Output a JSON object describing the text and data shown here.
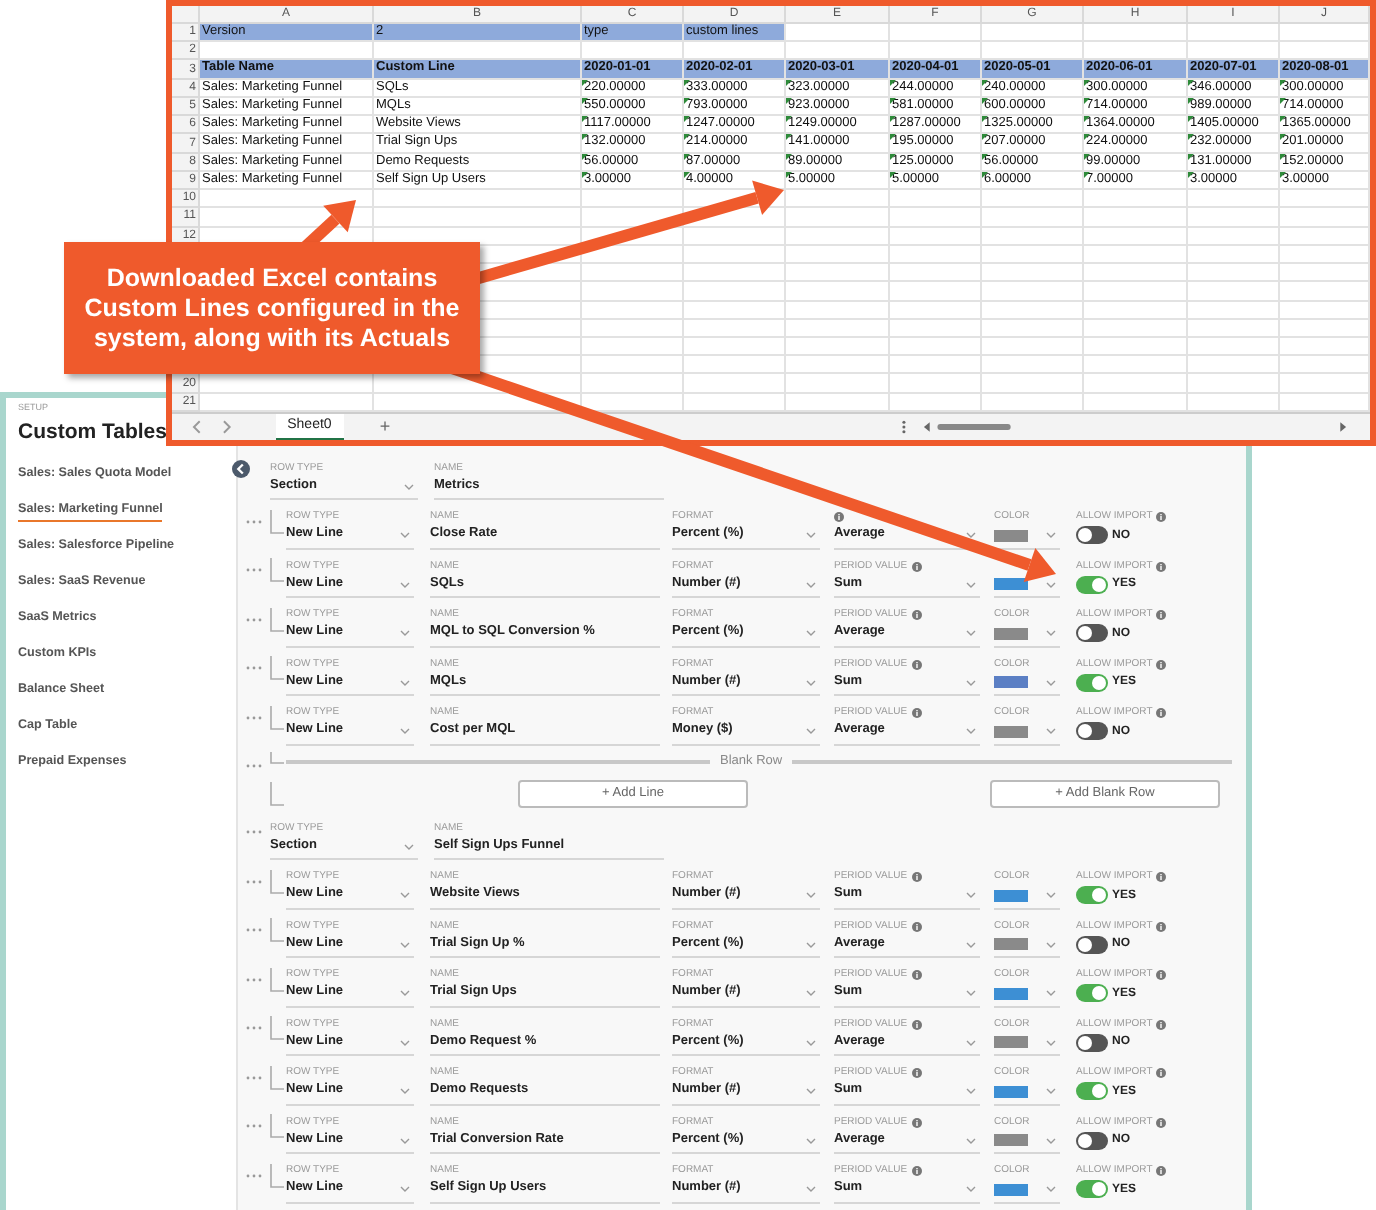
{
  "spreadsheet": {
    "column_headers": [
      "A",
      "B",
      "C",
      "D",
      "E",
      "F",
      "G",
      "H",
      "I",
      "J"
    ],
    "rows": [
      {
        "number": "1",
        "kind": "meta",
        "cells": [
          "Version",
          "2",
          "type",
          "custom lines"
        ]
      },
      {
        "number": "2",
        "kind": "blank",
        "cells": []
      },
      {
        "number": "3",
        "kind": "header",
        "cells": [
          "Table Name",
          "Custom Line",
          "2020-01-01",
          "2020-02-01",
          "2020-03-01",
          "2020-04-01",
          "2020-05-01",
          "2020-06-01",
          "2020-07-01",
          "2020-08-01"
        ]
      },
      {
        "number": "4",
        "kind": "data",
        "cells": [
          "Sales: Marketing Funnel",
          "SQLs",
          "220.00000",
          "333.00000",
          "323.00000",
          "244.00000",
          "240.00000",
          "300.00000",
          "346.00000",
          "300.00000"
        ]
      },
      {
        "number": "5",
        "kind": "data",
        "cells": [
          "Sales: Marketing Funnel",
          "MQLs",
          "550.00000",
          "793.00000",
          "923.00000",
          "581.00000",
          "600.00000",
          "714.00000",
          "989.00000",
          "714.00000"
        ]
      },
      {
        "number": "6",
        "kind": "data",
        "cells": [
          "Sales: Marketing Funnel",
          "Website Views",
          "1117.00000",
          "1247.00000",
          "1249.00000",
          "1287.00000",
          "1325.00000",
          "1364.00000",
          "1405.00000",
          "1365.00000"
        ]
      },
      {
        "number": "7",
        "kind": "data",
        "cells": [
          "Sales: Marketing Funnel",
          "Trial Sign Ups",
          "132.00000",
          "214.00000",
          "141.00000",
          "195.00000",
          "207.00000",
          "224.00000",
          "232.00000",
          "201.00000"
        ]
      },
      {
        "number": "8",
        "kind": "data",
        "cells": [
          "Sales: Marketing Funnel",
          "Demo Requests",
          "56.00000",
          "87.00000",
          "89.00000",
          "125.00000",
          "56.00000",
          "99.00000",
          "131.00000",
          "152.00000"
        ]
      },
      {
        "number": "9",
        "kind": "data",
        "cells": [
          "Sales: Marketing Funnel",
          "Self Sign Up Users",
          "3.00000",
          "4.00000",
          "5.00000",
          "5.00000",
          "6.00000",
          "7.00000",
          "3.00000",
          "3.00000"
        ]
      },
      {
        "number": "10",
        "kind": "blank",
        "cells": []
      },
      {
        "number": "11",
        "kind": "blank",
        "cells": []
      },
      {
        "number": "12",
        "kind": "blank",
        "cells": []
      },
      {
        "number": "20",
        "kind": "blank",
        "cells": [],
        "gap_before": true
      },
      {
        "number": "21",
        "kind": "blank",
        "cells": []
      }
    ],
    "sheet_tab": {
      "label": "Sheet0",
      "selected": true
    },
    "add_sheet": "+"
  },
  "callout": {
    "text": "Downloaded Excel contains Custom Lines configured in the system, along with its Actuals"
  },
  "app": {
    "sidebar": {
      "overline": "SETUP",
      "title": "Custom Tables",
      "items": [
        {
          "label": "Sales: Sales Quota Model",
          "selected": false
        },
        {
          "label": "Sales: Marketing Funnel",
          "selected": true
        },
        {
          "label": "Sales: Salesforce Pipeline",
          "selected": false
        },
        {
          "label": "Sales: SaaS Revenue",
          "selected": false
        },
        {
          "label": "SaaS Metrics",
          "selected": false
        },
        {
          "label": "Custom KPIs",
          "selected": false
        },
        {
          "label": "Balance Sheet",
          "selected": false
        },
        {
          "label": "Cap Table",
          "selected": false
        },
        {
          "label": "Prepaid Expenses",
          "selected": false
        }
      ]
    },
    "rows": [
      {
        "kind": "section",
        "labels": {
          "row_type": "ROW TYPE",
          "name": "NAME"
        },
        "row_type": "Section",
        "name": "Metrics"
      },
      {
        "kind": "line",
        "labels": {
          "row_type": "ROW TYPE",
          "name": "NAME",
          "format": "FORMAT",
          "swatch": "COLOR",
          "allow_import": "ALLOW IMPORT"
        },
        "row_type": "New Line",
        "name": "Close Rate",
        "format": "Percent (%)",
        "period_value": "Average",
        "color": "#8a8a8a",
        "allow_import": {
          "on": false,
          "label": "NO"
        }
      },
      {
        "kind": "line",
        "labels": {
          "row_type": "ROW TYPE",
          "name": "NAME",
          "format": "FORMAT",
          "period_value": "PERIOD VALUE",
          "allow_import": "ALLOW IMPORT"
        },
        "row_type": "New Line",
        "name": "SQLs",
        "format": "Number (#)",
        "period_value": "Sum",
        "color": "#3d8fd4",
        "allow_import": {
          "on": true,
          "label": "YES"
        }
      },
      {
        "kind": "line",
        "labels": {
          "row_type": "ROW TYPE",
          "name": "NAME",
          "format": "FORMAT",
          "period_value": "PERIOD VALUE",
          "swatch": "COLOR",
          "allow_import": "ALLOW IMPORT"
        },
        "row_type": "New Line",
        "name": "MQL to SQL Conversion %",
        "format": "Percent (%)",
        "period_value": "Average",
        "color": "#8a8a8a",
        "allow_import": {
          "on": false,
          "label": "NO"
        }
      },
      {
        "kind": "line",
        "labels": {
          "row_type": "ROW TYPE",
          "name": "NAME",
          "format": "FORMAT",
          "period_value": "PERIOD VALUE",
          "swatch": "COLOR",
          "allow_import": "ALLOW IMPORT"
        },
        "row_type": "New Line",
        "name": "MQLs",
        "format": "Number (#)",
        "period_value": "Sum",
        "color": "#5b7fc4",
        "allow_import": {
          "on": true,
          "label": "YES"
        }
      },
      {
        "kind": "line",
        "labels": {
          "row_type": "ROW TYPE",
          "name": "NAME",
          "format": "FORMAT",
          "period_value": "PERIOD VALUE",
          "swatch": "COLOR",
          "allow_import": "ALLOW IMPORT"
        },
        "row_type": "New Line",
        "name": "Cost per MQL",
        "format": "Money ($)",
        "period_value": "Average",
        "color": "#8a8a8a",
        "allow_import": {
          "on": false,
          "label": "NO"
        }
      },
      {
        "kind": "blank",
        "label": "Blank Row"
      },
      {
        "kind": "add",
        "buttons": [
          "+ Add Line",
          "+ Add Blank Row"
        ]
      },
      {
        "kind": "section",
        "labels": {
          "row_type": "ROW TYPE",
          "name": "NAME"
        },
        "row_type": "Section",
        "name": "Self Sign Ups Funnel"
      },
      {
        "kind": "line",
        "labels": {
          "row_type": "ROW TYPE",
          "name": "NAME",
          "format": "FORMAT",
          "period_value": "PERIOD VALUE",
          "swatch": "COLOR",
          "allow_import": "ALLOW IMPORT"
        },
        "row_type": "New Line",
        "name": "Website Views",
        "format": "Number (#)",
        "period_value": "Sum",
        "color": "#3d8fd4",
        "allow_import": {
          "on": true,
          "label": "YES"
        }
      },
      {
        "kind": "line",
        "labels": {
          "row_type": "ROW TYPE",
          "name": "NAME",
          "format": "FORMAT",
          "period_value": "PERIOD VALUE",
          "swatch": "COLOR",
          "allow_import": "ALLOW IMPORT"
        },
        "row_type": "New Line",
        "name": "Trial Sign Up %",
        "format": "Percent (%)",
        "period_value": "Average",
        "color": "#8a8a8a",
        "allow_import": {
          "on": false,
          "label": "NO"
        }
      },
      {
        "kind": "line",
        "labels": {
          "row_type": "ROW TYPE",
          "name": "NAME",
          "format": "FORMAT",
          "period_value": "PERIOD VALUE",
          "swatch": "COLOR",
          "allow_import": "ALLOW IMPORT"
        },
        "row_type": "New Line",
        "name": "Trial Sign Ups",
        "format": "Number (#)",
        "period_value": "Sum",
        "color": "#3d8fd4",
        "allow_import": {
          "on": true,
          "label": "YES"
        }
      },
      {
        "kind": "line",
        "labels": {
          "row_type": "ROW TYPE",
          "name": "NAME",
          "format": "FORMAT",
          "period_value": "PERIOD VALUE",
          "swatch": "COLOR",
          "allow_import": "ALLOW IMPORT"
        },
        "row_type": "New Line",
        "name": "Demo Request %",
        "format": "Percent (%)",
        "period_value": "Average",
        "color": "#8a8a8a",
        "allow_import": {
          "on": false,
          "label": "NO"
        }
      },
      {
        "kind": "line",
        "labels": {
          "row_type": "ROW TYPE",
          "name": "NAME",
          "format": "FORMAT",
          "period_value": "PERIOD VALUE",
          "swatch": "COLOR",
          "allow_import": "ALLOW IMPORT"
        },
        "row_type": "New Line",
        "name": "Demo Requests",
        "format": "Number (#)",
        "period_value": "Sum",
        "color": "#3d8fd4",
        "allow_import": {
          "on": true,
          "label": "YES"
        }
      },
      {
        "kind": "line",
        "labels": {
          "row_type": "ROW TYPE",
          "name": "NAME",
          "format": "FORMAT",
          "period_value": "PERIOD VALUE",
          "swatch": "COLOR",
          "allow_import": "ALLOW IMPORT"
        },
        "row_type": "New Line",
        "name": "Trial Conversion Rate",
        "format": "Percent (%)",
        "period_value": "Average",
        "color": "#8a8a8a",
        "allow_import": {
          "on": false,
          "label": "NO"
        }
      },
      {
        "kind": "line",
        "labels": {
          "row_type": "ROW TYPE",
          "name": "NAME",
          "format": "FORMAT",
          "period_value": "PERIOD VALUE",
          "swatch": "COLOR",
          "allow_import": "ALLOW IMPORT"
        },
        "row_type": "New Line",
        "name": "Self Sign Up Users",
        "format": "Number (#)",
        "period_value": "Sum",
        "color": "#3d8fd4",
        "allow_import": {
          "on": true,
          "label": "YES"
        }
      }
    ]
  }
}
